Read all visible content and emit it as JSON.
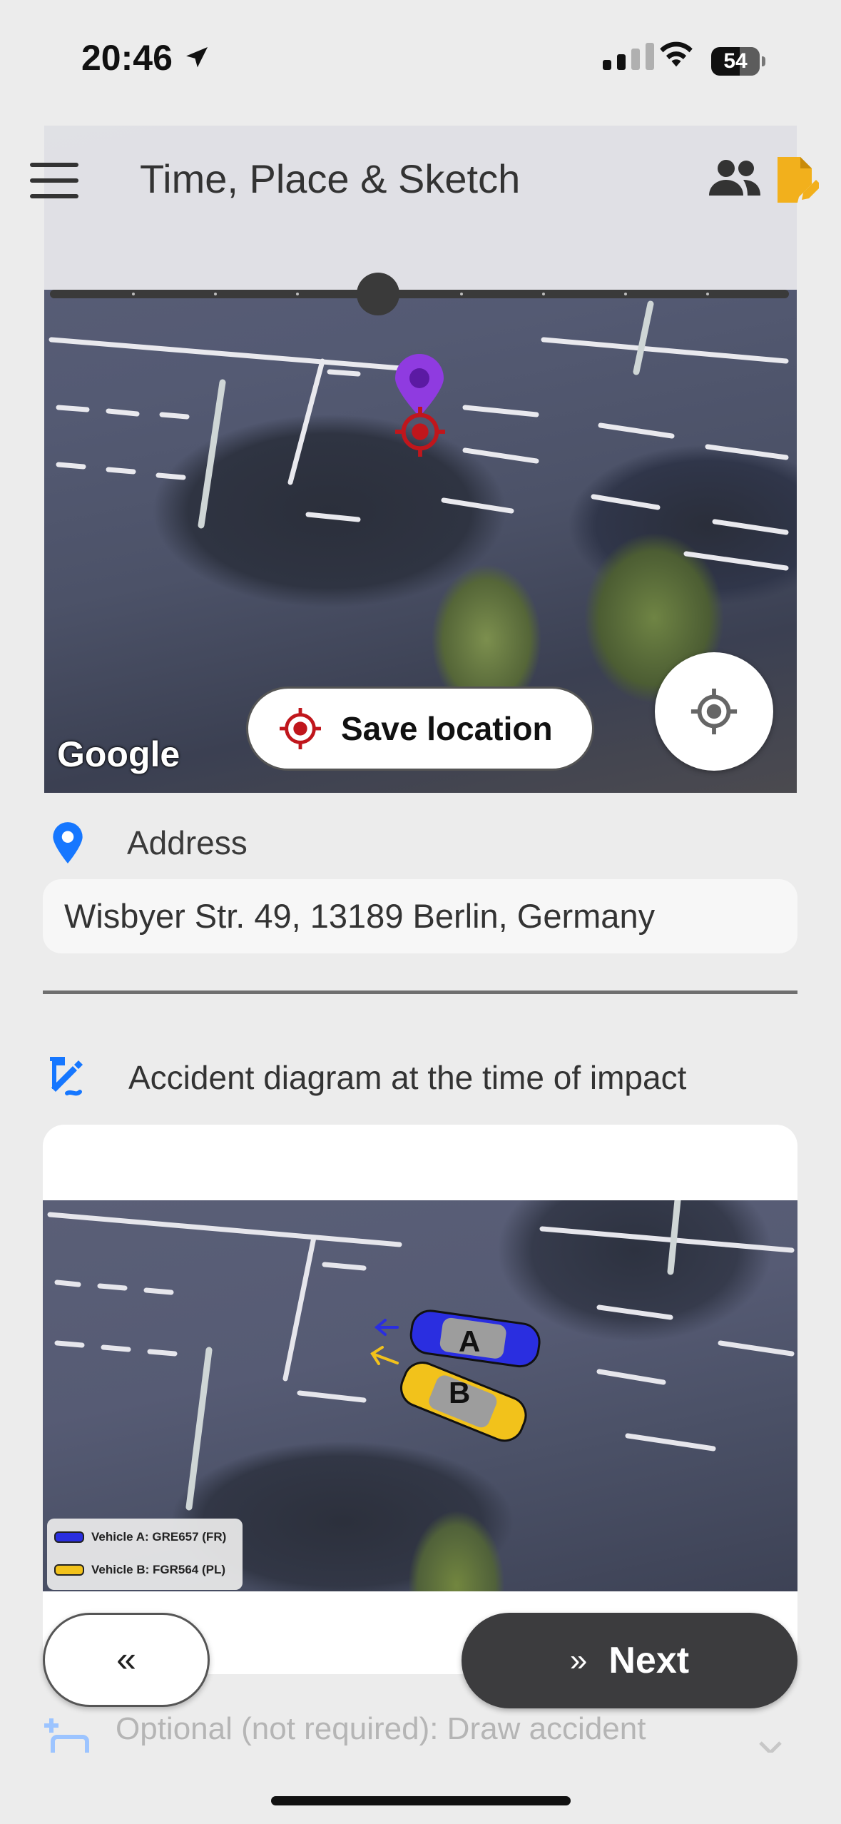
{
  "status_bar": {
    "time": "20:46",
    "battery": "54"
  },
  "header": {
    "title": "Time, Place & Sketch"
  },
  "map": {
    "attribution": "Google",
    "save_location_label": "Save location"
  },
  "address": {
    "label": "Address",
    "value": "Wisbyer Str. 49, 13189 Berlin, Germany"
  },
  "diagram": {
    "label": "Accident diagram at the time of impact",
    "vehicle_a_marker": "A",
    "vehicle_b_marker": "B",
    "legend": [
      {
        "text": "Vehicle A: GRE657 (FR)",
        "color": "#2a2ee0"
      },
      {
        "text": "Vehicle B: FGR564 (PL)",
        "color": "#f2c21b"
      }
    ]
  },
  "nav": {
    "back_label": "«",
    "next_chevron": "»",
    "next_label": "Next"
  },
  "optional": {
    "label": "Optional (not required): Draw accident"
  },
  "colors": {
    "accent_blue": "#1677ff",
    "pin_purple": "#8f3be0",
    "target_red": "#c0161c",
    "doc_yellow": "#f2b01c"
  }
}
